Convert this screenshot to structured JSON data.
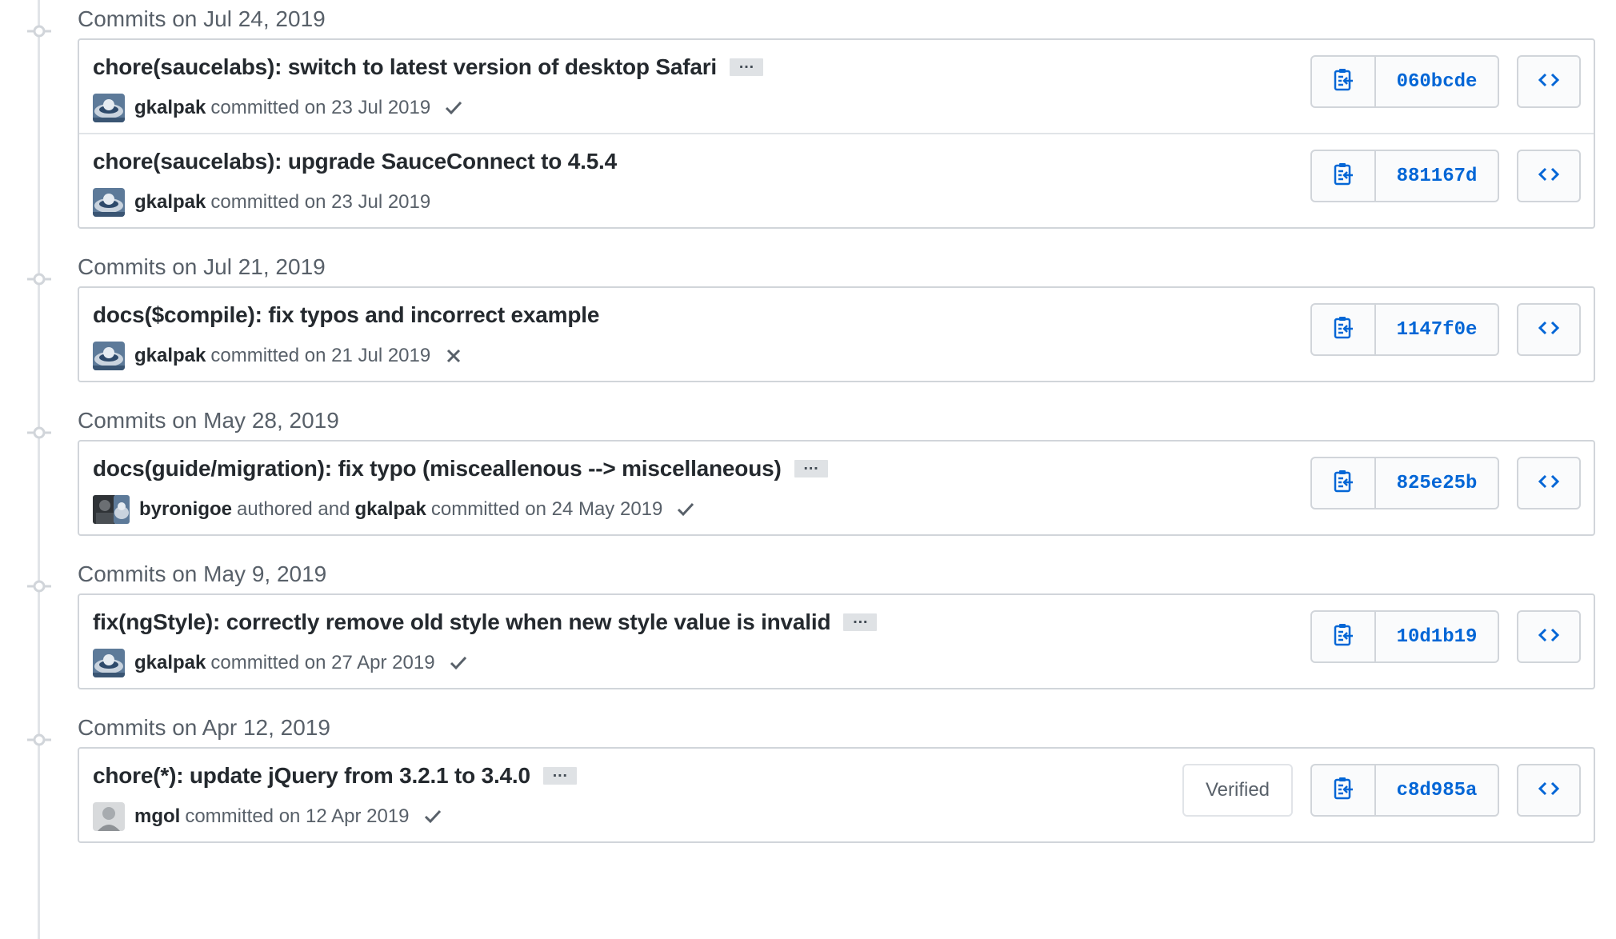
{
  "colors": {
    "accent": "#0366d6",
    "success": "#28a745",
    "border": "#d1d5da",
    "muted": "#586069"
  },
  "groups": [
    {
      "header": "Commits on Jul 24, 2019",
      "commits": [
        {
          "message": "chore(saucelabs): switch to latest version of desktop Safari",
          "has_more": true,
          "author": "gkalpak",
          "meta_text": "committed on 23 Jul 2019",
          "status": "success",
          "sha": "060bcde"
        },
        {
          "message": "chore(saucelabs): upgrade SauceConnect to 4.5.4",
          "has_more": false,
          "author": "gkalpak",
          "meta_text": "committed on 23 Jul 2019",
          "status": "none",
          "sha": "881167d"
        }
      ]
    },
    {
      "header": "Commits on Jul 21, 2019",
      "commits": [
        {
          "message": "docs($compile): fix typos and incorrect example",
          "has_more": false,
          "author": "gkalpak",
          "meta_text": "committed on 21 Jul 2019",
          "status": "failure",
          "sha": "1147f0e"
        }
      ]
    },
    {
      "header": "Commits on May 28, 2019",
      "commits": [
        {
          "message": "docs(guide/migration): fix typo (misceallenous --> miscellaneous)",
          "has_more": true,
          "author": "byronigoe",
          "meta_middle": "authored and",
          "committer": "gkalpak",
          "meta_text": "committed on 24 May 2019",
          "status": "success",
          "sha": "825e25b"
        }
      ]
    },
    {
      "header": "Commits on May 9, 2019",
      "commits": [
        {
          "message": "fix(ngStyle): correctly remove old style when new style value is invalid",
          "has_more": true,
          "author": "gkalpak",
          "meta_text": "committed on 27 Apr 2019",
          "status": "success",
          "sha": "10d1b19"
        }
      ]
    },
    {
      "header": "Commits on Apr 12, 2019",
      "commits": [
        {
          "message": "chore(*): update jQuery from 3.2.1 to 3.4.0",
          "has_more": true,
          "author": "mgol",
          "meta_text": "committed on 12 Apr 2019",
          "status": "success",
          "verified": "Verified",
          "sha": "c8d985a"
        }
      ]
    }
  ],
  "ellipsis_label": "…",
  "icons": {
    "copy": "clippy-icon",
    "browse": "code-icon",
    "success": "check-icon",
    "failure": "x-icon",
    "timeline": "git-commit-icon"
  }
}
